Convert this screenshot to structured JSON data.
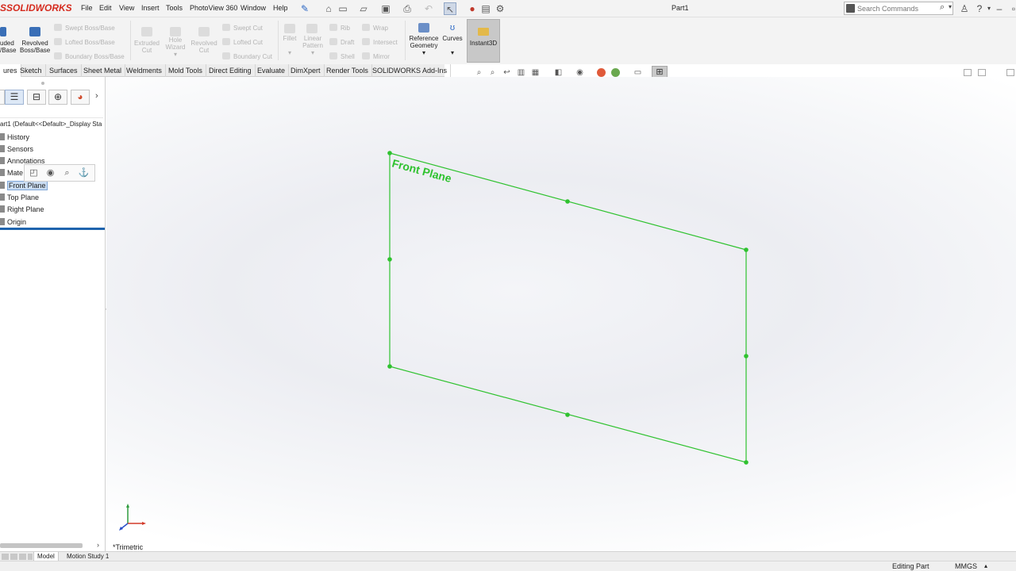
{
  "app": {
    "brand": "SOLIDWORKS",
    "document_title": "Part1"
  },
  "menu": [
    "File",
    "Edit",
    "View",
    "Insert",
    "Tools",
    "PhotoView 360",
    "Window",
    "Help"
  ],
  "search": {
    "placeholder": "Search Commands"
  },
  "ribbon": {
    "extruded_boss_line1": "uded",
    "extruded_boss_line2": "/Base",
    "revolved_boss_line1": "Revolved",
    "revolved_boss_line2": "Boss/Base",
    "swept_boss": "Swept Boss/Base",
    "lofted_boss": "Lofted Boss/Base",
    "boundary_boss": "Boundary Boss/Base",
    "extruded_cut_line1": "Extruded",
    "extruded_cut_line2": "Cut",
    "hole_wizard_line1": "Hole",
    "hole_wizard_line2": "Wizard",
    "revolved_cut_line1": "Revolved",
    "revolved_cut_line2": "Cut",
    "swept_cut": "Swept Cut",
    "lofted_cut": "Lofted Cut",
    "boundary_cut": "Boundary Cut",
    "fillet": "Fillet",
    "linear_pattern_line1": "Linear",
    "linear_pattern_line2": "Pattern",
    "rib": "Rib",
    "wrap": "Wrap",
    "draft": "Draft",
    "intersect": "Intersect",
    "shell": "Shell",
    "mirror": "Mirror",
    "reference_geometry_line1": "Reference",
    "reference_geometry_line2": "Geometry",
    "curves": "Curves",
    "instant3d": "Instant3D"
  },
  "tabs": [
    {
      "label": "ures",
      "active": true
    },
    {
      "label": "Sketch"
    },
    {
      "label": "Surfaces"
    },
    {
      "label": "Sheet Metal"
    },
    {
      "label": "Weldments"
    },
    {
      "label": "Mold Tools"
    },
    {
      "label": "Direct Editing"
    },
    {
      "label": "Evaluate"
    },
    {
      "label": "DimXpert"
    },
    {
      "label": "Render Tools"
    },
    {
      "label": "SOLIDWORKS Add-Ins"
    }
  ],
  "feature_tree": {
    "root": "art1  (Default<<Default>_Display Sta",
    "items": [
      {
        "label": "History"
      },
      {
        "label": "Sensors"
      },
      {
        "label": "Annotations"
      },
      {
        "label": "Mate"
      },
      {
        "label": "Front Plane",
        "selected": true
      },
      {
        "label": "Top Plane"
      },
      {
        "label": "Right Plane"
      },
      {
        "label": "Origin"
      }
    ]
  },
  "viewport": {
    "plane_label": "Front Plane",
    "view_name": "*Trimetric",
    "plane_color": "#2fc22f"
  },
  "bottom_tabs": [
    {
      "label": "Model",
      "active": true
    },
    {
      "label": "Motion Study 1"
    }
  ],
  "status": {
    "mode": "Editing Part",
    "units": "MMGS"
  },
  "colors": {
    "brand_red": "#d52b1e",
    "selection_blue": "#1e63ad"
  }
}
